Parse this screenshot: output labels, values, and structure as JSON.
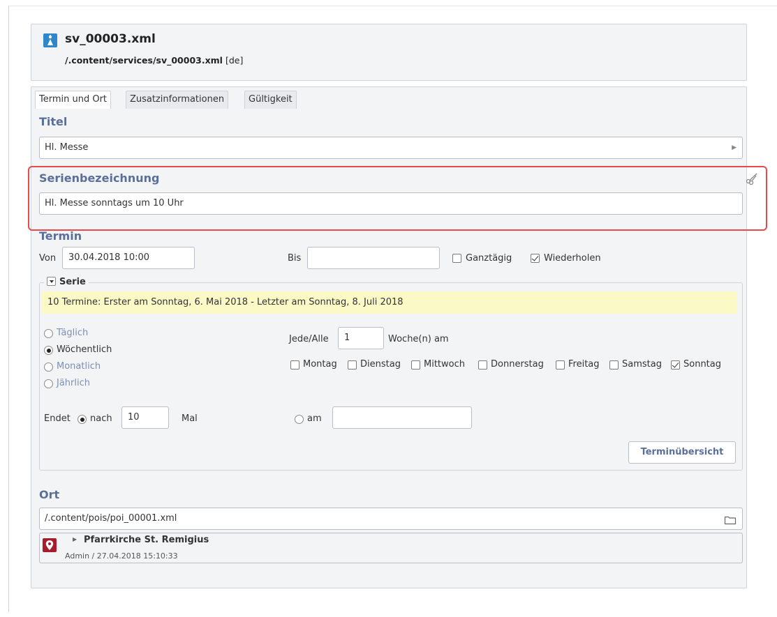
{
  "header": {
    "file_name": "sv_00003.xml",
    "path": "/.content/services/sv_00003.xml",
    "locale": "[de]"
  },
  "tabs": [
    {
      "label": "Termin und Ort",
      "active": true
    },
    {
      "label": "Zusatzinformationen",
      "active": false
    },
    {
      "label": "Gültigkeit",
      "active": false
    }
  ],
  "titel": {
    "label": "Titel",
    "value": "Hl. Messe"
  },
  "serienbezeichnung": {
    "label": "Serienbezeichnung",
    "value": "Hl. Messe sonntags um 10 Uhr"
  },
  "termin": {
    "label": "Termin",
    "von_label": "Von",
    "von_value": "30.04.2018 10:00",
    "bis_label": "Bis",
    "bis_value": "",
    "ganztaegig_label": "Ganztägig",
    "ganztaegig_checked": false,
    "wiederholen_label": "Wiederholen",
    "wiederholen_checked": true
  },
  "serie": {
    "label": "Serie",
    "info": "10 Termine: Erster am Sonntag, 6. Mai 2018 - Letzter am Sonntag, 8. Juli 2018",
    "patterns": [
      {
        "label": "Täglich",
        "checked": false
      },
      {
        "label": "Wöchentlich",
        "checked": true
      },
      {
        "label": "Monatlich",
        "checked": false
      },
      {
        "label": "Jährlich",
        "checked": false
      }
    ],
    "jede_label": "Jede/Alle",
    "jede_value": "1",
    "woche_label": "Woche(n) am",
    "days": [
      {
        "label": "Montag",
        "checked": false
      },
      {
        "label": "Dienstag",
        "checked": false
      },
      {
        "label": "Mittwoch",
        "checked": false
      },
      {
        "label": "Donnerstag",
        "checked": false
      },
      {
        "label": "Freitag",
        "checked": false
      },
      {
        "label": "Samstag",
        "checked": false
      },
      {
        "label": "Sonntag",
        "checked": true
      }
    ],
    "endet_label": "Endet",
    "nach_label": "nach",
    "nach_value": "10",
    "mal_label": "Mal",
    "am_label": "am",
    "am_value": "",
    "overview_button": "Terminübersicht"
  },
  "ort": {
    "label": "Ort",
    "path_value": "/.content/pois/poi_00001.xml",
    "poi_title": "Pfarrkirche St. Remigius",
    "poi_meta": "Admin / 27.04.2018 15:10:33"
  }
}
